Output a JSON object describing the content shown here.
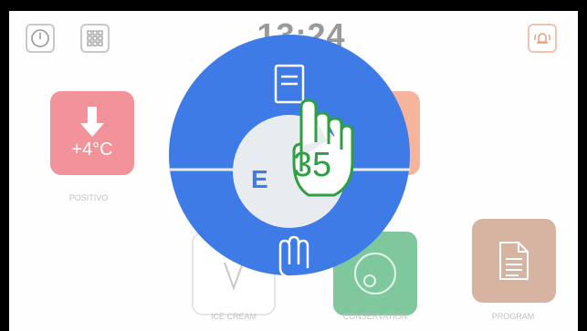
{
  "header": {
    "clock": "13:24"
  },
  "icons": {
    "power": "power-icon",
    "apps": "apps-grid-icon",
    "alarm": "alarm-bell-icon",
    "hand": "hand-icon",
    "touch": "touch-pointer-icon"
  },
  "tiles": {
    "positivo": {
      "value": "+4°C",
      "label": "POSITIVO"
    },
    "icecream": {
      "label": "ICE CREAM"
    },
    "conservation": {
      "label": "CONSERVATION"
    },
    "program": {
      "label": "PROGRAM"
    }
  },
  "dial": {
    "hint_number": "35",
    "center_letter": "E"
  },
  "colors": {
    "wheel_blue": "#3e7be6",
    "hint_green": "#2ea043",
    "positivo_red": "#f2939a",
    "conservation_green": "#7fc89d",
    "program_tan": "#d7b3a1"
  }
}
